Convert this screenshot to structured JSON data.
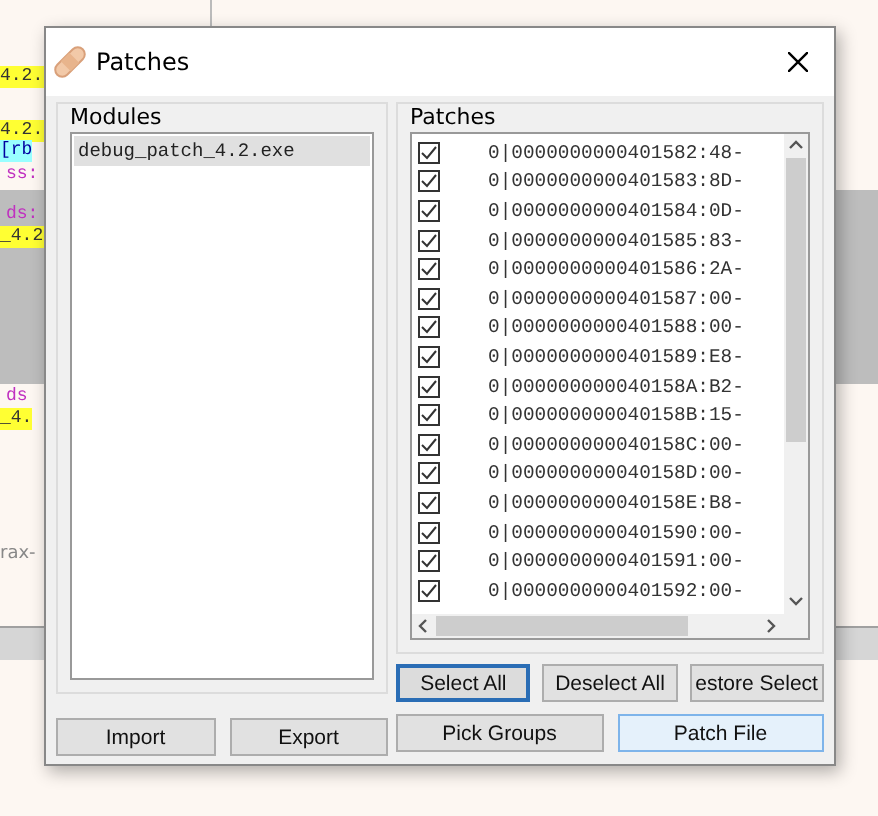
{
  "background": {
    "texts": [
      {
        "text": "4.2.",
        "kind": "highlight"
      },
      {
        "text": "4.2.",
        "kind": "highlight"
      },
      {
        "text": "[rb",
        "kind": "register"
      },
      {
        "text": "ss:",
        "kind": "segment"
      },
      {
        "text": "ds:",
        "kind": "segment"
      },
      {
        "text": "_4.2",
        "kind": "highlight"
      },
      {
        "text": "ds",
        "kind": "segment"
      },
      {
        "text": "_4.",
        "kind": "highlight"
      },
      {
        "text": "rax-",
        "kind": "comment"
      }
    ]
  },
  "dialog": {
    "title": "Patches",
    "modules": {
      "label": "Modules",
      "items": [
        {
          "name": "debug_patch_4.2.exe",
          "selected": true
        }
      ]
    },
    "patches": {
      "label": "Patches",
      "rows": [
        {
          "text": "0|0000000000401582:48-",
          "checked": true
        },
        {
          "text": "0|0000000000401583:8D-",
          "checked": true
        },
        {
          "text": "0|0000000000401584:0D-",
          "checked": true
        },
        {
          "text": "0|0000000000401585:83-",
          "checked": true
        },
        {
          "text": "0|0000000000401586:2A-",
          "checked": true
        },
        {
          "text": "0|0000000000401587:00-",
          "checked": true
        },
        {
          "text": "0|0000000000401588:00-",
          "checked": true
        },
        {
          "text": "0|0000000000401589:E8-",
          "checked": true
        },
        {
          "text": "0|000000000040158A:B2-",
          "checked": true
        },
        {
          "text": "0|000000000040158B:15-",
          "checked": true
        },
        {
          "text": "0|000000000040158C:00-",
          "checked": true
        },
        {
          "text": "0|000000000040158D:00-",
          "checked": true
        },
        {
          "text": "0|000000000040158E:B8-",
          "checked": true
        },
        {
          "text": "0|0000000000401590:00-",
          "checked": true
        },
        {
          "text": "0|0000000000401591:00-",
          "checked": true
        },
        {
          "text": "0|0000000000401592:00-",
          "checked": true
        }
      ]
    },
    "left_buttons": [
      {
        "label": "Import",
        "selected": false
      },
      {
        "label": "Export",
        "selected": false
      }
    ],
    "right_buttons": [
      {
        "label": "Select All",
        "selected": true
      },
      {
        "label": "Deselect All",
        "selected": false
      },
      {
        "label": "estore Select",
        "selected": false
      },
      {
        "label": "Pick Groups",
        "selected": false
      },
      {
        "label": "Patch File",
        "selected": false,
        "kind": "primary"
      }
    ]
  }
}
